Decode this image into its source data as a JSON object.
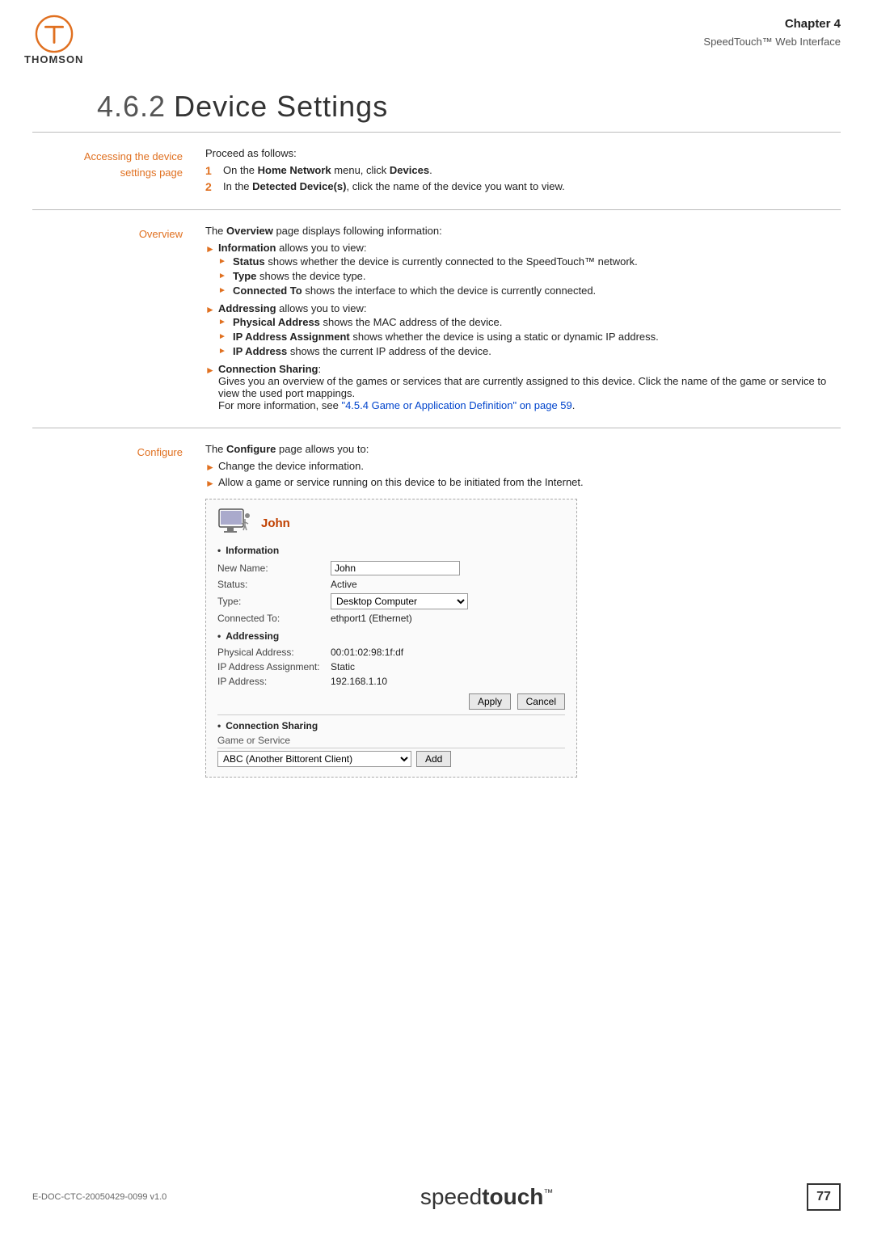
{
  "header": {
    "chapter_label": "Chapter 4",
    "chapter_sub": "SpeedTouch™ Web Interface"
  },
  "page_title": {
    "number": "4.6.2",
    "title": "Device Settings"
  },
  "sections": {
    "accessing": {
      "label_line1": "Accessing the device",
      "label_line2": "settings page",
      "intro": "Proceed as follows:",
      "steps": [
        {
          "num": "1",
          "text_before": "On the ",
          "bold1": "Home Network",
          "text_mid": " menu, click ",
          "bold2": "Devices",
          "text_after": "."
        },
        {
          "num": "2",
          "text_before": "In the ",
          "bold1": "Detected Device(s)",
          "text_mid": ", click the name of the device you want to view.",
          "text_after": ""
        }
      ]
    },
    "overview": {
      "label": "Overview",
      "intro_bold": "Overview",
      "intro_text": " page displays following information:",
      "bullets": [
        {
          "bold": "Information",
          "text": " allows you to view:",
          "sub": [
            {
              "bold": "Status",
              "text": " shows whether the device is currently connected to the SpeedTouch™ network."
            },
            {
              "bold": "Type",
              "text": " shows the device type."
            },
            {
              "bold": "Connected To",
              "text": " shows the interface to which the device is currently connected."
            }
          ]
        },
        {
          "bold": "Addressing",
          "text": " allows you to view:",
          "sub": [
            {
              "bold": "Physical Address",
              "text": " shows the MAC address of the device."
            },
            {
              "bold": "IP Address Assignment",
              "text": " shows whether the device is using a static or dynamic IP address."
            },
            {
              "bold": "IP Address",
              "text": " shows the current IP address of the device."
            }
          ]
        },
        {
          "bold": "Connection Sharing",
          "text": ":",
          "extra_text": "Gives you an overview of the games or services that are currently assigned to this device. Click the name of the game or service to view the used port mappings.",
          "link_text": "\"4.5.4 Game or Application Definition\" on page 59",
          "link_prefix": "For more information, see "
        }
      ]
    },
    "configure": {
      "label": "Configure",
      "intro_bold": "Configure",
      "intro_text": " page allows you to:",
      "bullets": [
        {
          "text": "Change the device information."
        },
        {
          "text": "Allow a game or service running on this device to be initiated from the Internet."
        }
      ]
    }
  },
  "device_card": {
    "name": "John",
    "information_label": "Information",
    "fields": {
      "new_name_label": "New Name:",
      "new_name_value": "John",
      "status_label": "Status:",
      "status_value": "Active",
      "type_label": "Type:",
      "type_value": "Desktop Computer",
      "connected_to_label": "Connected To:",
      "connected_to_value": "ethport1 (Ethernet)"
    },
    "addressing_label": "Addressing",
    "addressing_fields": {
      "physical_label": "Physical Address:",
      "physical_value": "00:01:02:98:1f:df",
      "ip_assignment_label": "IP Address Assignment:",
      "ip_assignment_value": "Static",
      "ip_label": "IP Address:",
      "ip_value": "192.168.1.10"
    },
    "apply_button": "Apply",
    "cancel_button": "Cancel",
    "connection_sharing_label": "Connection Sharing",
    "game_service_label": "Game or Service",
    "game_service_option": "ABC (Another Bittorent Client)",
    "add_button": "Add"
  },
  "footer": {
    "doc_id": "E-DOC-CTC-20050429-0099 v1.0",
    "brand_speed": "speed",
    "brand_touch": "touch",
    "brand_tm": "™",
    "page_number": "77"
  }
}
